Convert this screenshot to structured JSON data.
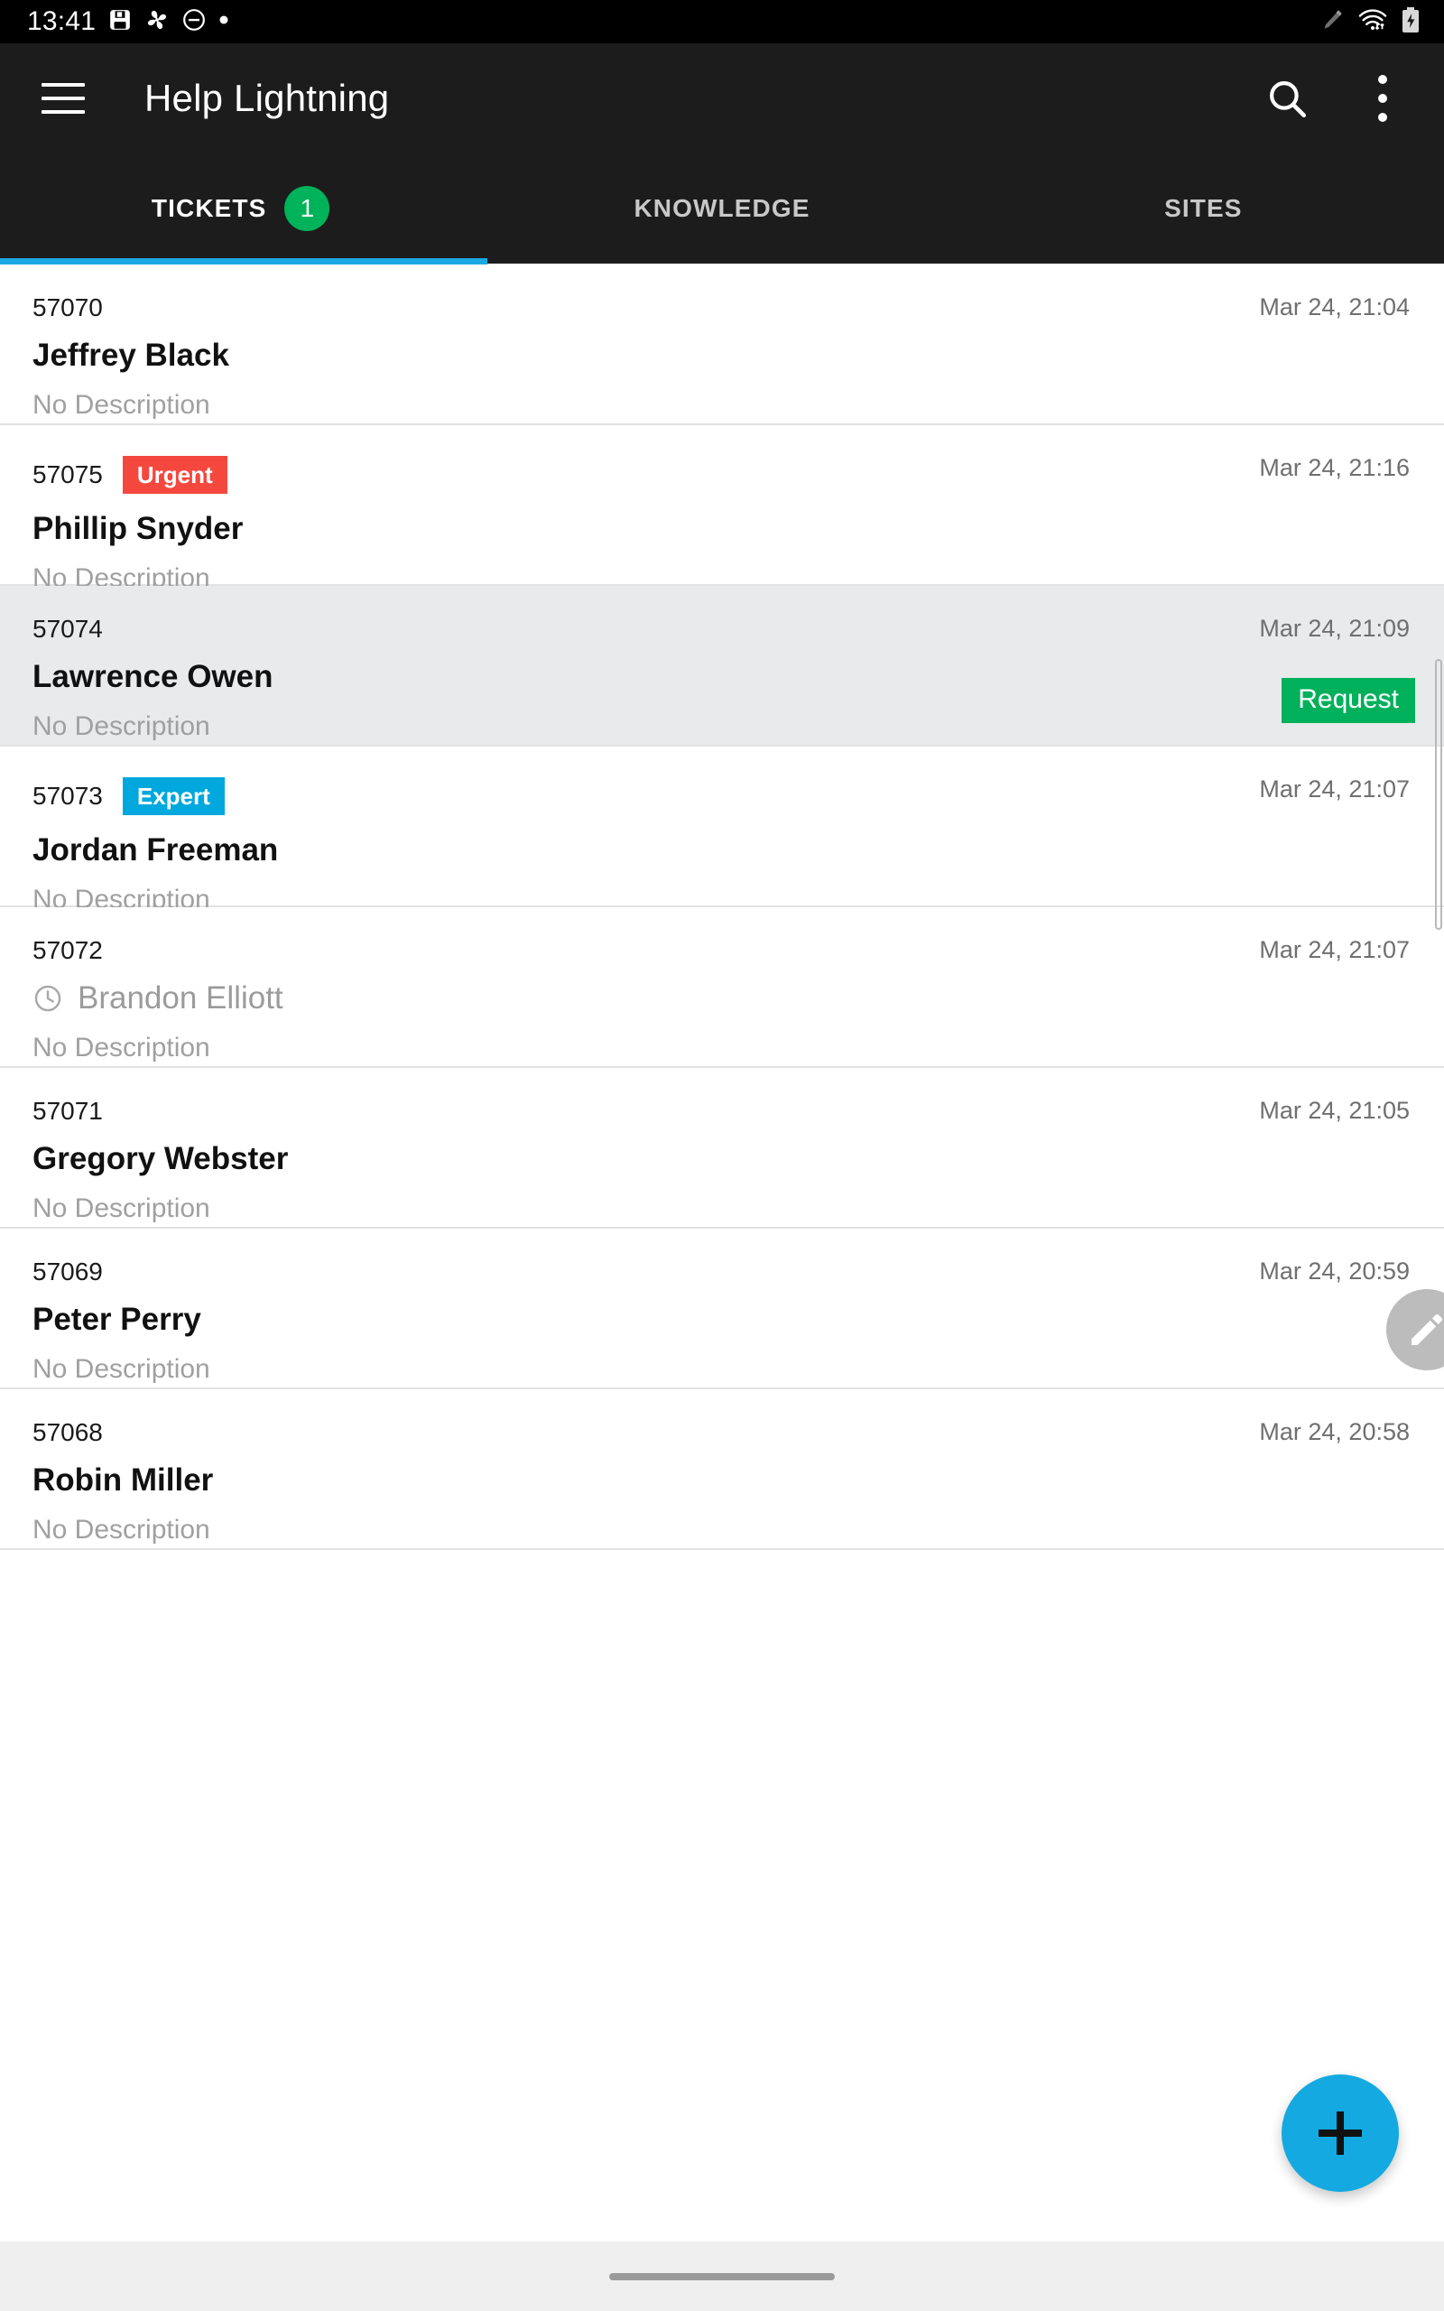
{
  "status_bar": {
    "time": "13:41",
    "left_icons": [
      "screenshot-icon",
      "fan-icon",
      "do-not-disturb-icon",
      "dot-indicator-icon"
    ],
    "right_icons": [
      "stylus-icon",
      "wifi-icon",
      "battery-charging-icon"
    ]
  },
  "app_bar": {
    "title": "Help Lightning",
    "menu_icon": "hamburger-menu-icon",
    "search_icon": "search-icon",
    "overflow_icon": "overflow-menu-icon"
  },
  "tabs": {
    "active_index": 0,
    "items": [
      {
        "label": "TICKETS",
        "badge": "1"
      },
      {
        "label": "KNOWLEDGE",
        "badge": ""
      },
      {
        "label": "SITES",
        "badge": ""
      }
    ]
  },
  "colors": {
    "accent": "#14a9e0",
    "tab_indicator": "#1ba8e0",
    "badge_count": "#00b259",
    "urgent": "#f4483f",
    "expert": "#00a8dd",
    "request": "#00b05a",
    "appbar_bg": "#1c1c1c",
    "status_bg": "#000000",
    "row_highlight": "#e8eaec"
  },
  "tickets": [
    {
      "id": "57070",
      "tag": "",
      "tag_type": "",
      "name": "Jeffrey Black",
      "description": "No Description",
      "time": "Mar 24, 21:04",
      "highlighted": false,
      "pending": false,
      "action": ""
    },
    {
      "id": "57075",
      "tag": "Urgent",
      "tag_type": "urgent",
      "name": "Phillip Snyder",
      "description": "No Description",
      "time": "Mar 24, 21:16",
      "highlighted": false,
      "pending": false,
      "action": ""
    },
    {
      "id": "57074",
      "tag": "",
      "tag_type": "",
      "name": "Lawrence Owen",
      "description": "No Description",
      "time": "Mar 24, 21:09",
      "highlighted": true,
      "pending": false,
      "action": "Request"
    },
    {
      "id": "57073",
      "tag": "Expert",
      "tag_type": "expert",
      "name": "Jordan Freeman",
      "description": "No Description",
      "time": "Mar 24, 21:07",
      "highlighted": false,
      "pending": false,
      "action": ""
    },
    {
      "id": "57072",
      "tag": "",
      "tag_type": "",
      "name": "Brandon Elliott",
      "description": "No Description",
      "time": "Mar 24, 21:07",
      "highlighted": false,
      "pending": true,
      "action": ""
    },
    {
      "id": "57071",
      "tag": "",
      "tag_type": "",
      "name": "Gregory Webster",
      "description": "No Description",
      "time": "Mar 24, 21:05",
      "highlighted": false,
      "pending": false,
      "action": ""
    },
    {
      "id": "57069",
      "tag": "",
      "tag_type": "",
      "name": "Peter Perry",
      "description": "No Description",
      "time": "Mar 24, 20:59",
      "highlighted": false,
      "pending": false,
      "action": ""
    },
    {
      "id": "57068",
      "tag": "",
      "tag_type": "",
      "name": "Robin Miller",
      "description": "No Description",
      "time": "Mar 24, 20:58",
      "highlighted": false,
      "pending": false,
      "action": ""
    }
  ],
  "floating": {
    "edit_icon": "pencil-edit-icon",
    "fab_icon": "plus-icon"
  },
  "nav_bar": {
    "handle": "home-gesture-handle"
  }
}
